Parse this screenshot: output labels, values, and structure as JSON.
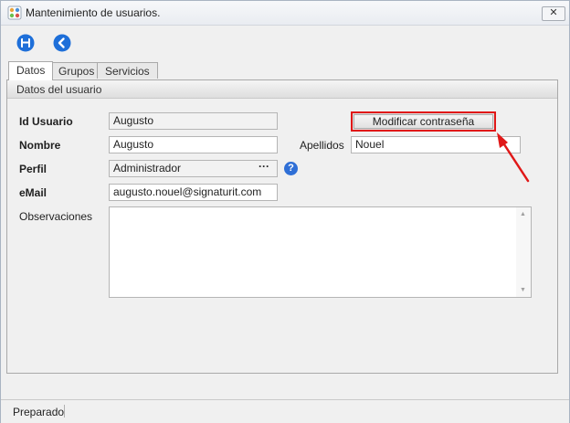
{
  "window": {
    "title": "Mantenimiento de usuarios.",
    "close_label": "✕"
  },
  "toolbar": {
    "save_icon": "floppy-disk-icon",
    "back_icon": "back-arrow-icon"
  },
  "tabs": [
    {
      "label": "Datos",
      "active": true
    },
    {
      "label": "Grupos",
      "active": false
    },
    {
      "label": "Servicios",
      "active": false
    }
  ],
  "section": {
    "title": "Datos del usuario"
  },
  "form": {
    "id_usuario": {
      "label": "Id Usuario",
      "value": "Augusto"
    },
    "nombre": {
      "label": "Nombre",
      "value": "Augusto"
    },
    "apellidos": {
      "label": "Apellidos",
      "value": "Nouel"
    },
    "perfil": {
      "label": "Perfil",
      "value": "Administrador",
      "ellipsis": "···",
      "help": "?"
    },
    "email": {
      "label": "eMail",
      "value": "augusto.nouel@signaturit.com"
    },
    "observaciones": {
      "label": "Observaciones",
      "value": ""
    }
  },
  "buttons": {
    "modify_password": "Modificar contraseña"
  },
  "status": {
    "text": "Preparado"
  },
  "colors": {
    "highlight": "#e01818",
    "accent": "#1e6fd9",
    "help": "#2f6fd6"
  }
}
